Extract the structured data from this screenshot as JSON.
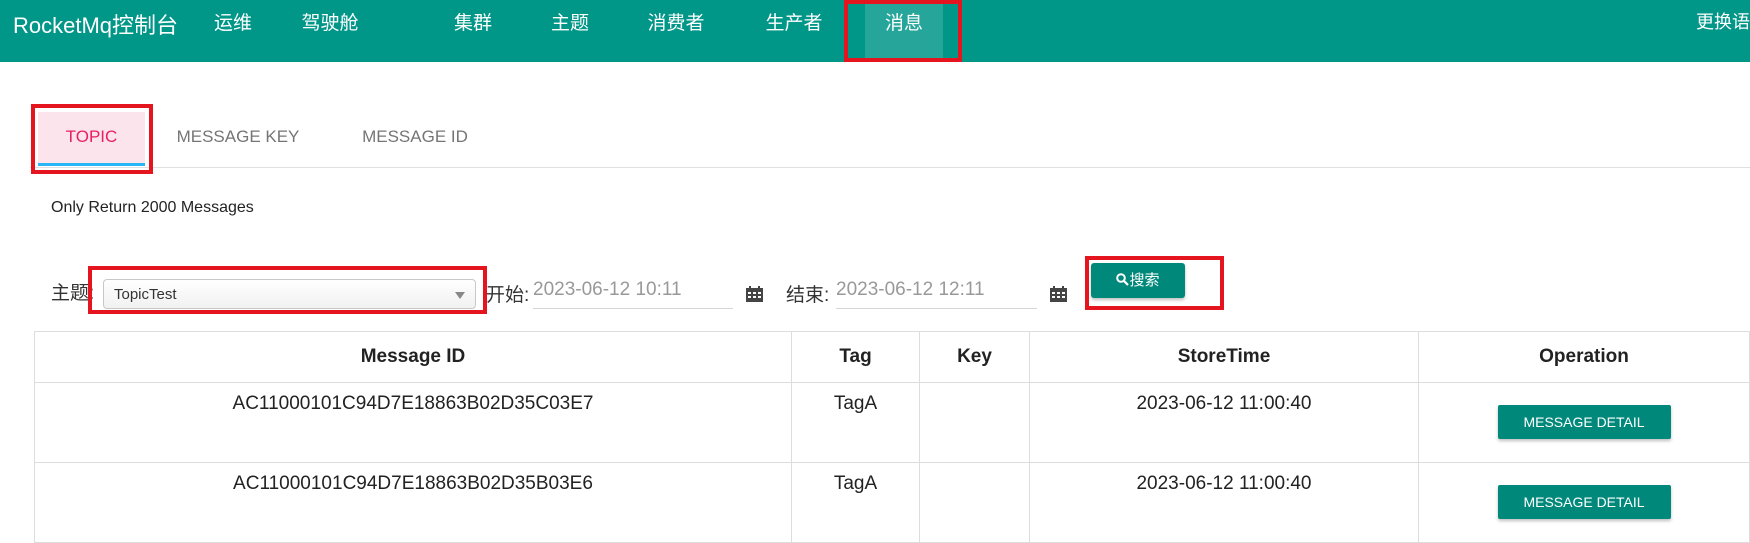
{
  "nav": {
    "brand": "RocketMq控制台",
    "items": [
      "运维",
      "驾驶舱",
      "集群",
      "主题",
      "消费者",
      "生产者",
      "消息"
    ],
    "active_index": 6,
    "lang": "更换语"
  },
  "tabs": [
    "TOPIC",
    "MESSAGE KEY",
    "MESSAGE ID"
  ],
  "active_tab": 0,
  "note": "Only Return 2000 Messages",
  "search": {
    "topic_label": "主题:",
    "topic_value": "TopicTest",
    "start_label": "开始:",
    "start_value": "2023-06-12 10:11",
    "end_label": "结束:",
    "end_value": "2023-06-12 12:11",
    "search_label": "搜索"
  },
  "table": {
    "headers": [
      "Message ID",
      "Tag",
      "Key",
      "StoreTime",
      "Operation"
    ],
    "rows": [
      {
        "id": "AC11000101C94D7E18863B02D35C03E7",
        "tag": "TagA",
        "key": "",
        "store_time": "2023-06-12 11:00:40",
        "op": "MESSAGE DETAIL"
      },
      {
        "id": "AC11000101C94D7E18863B02D35B03E6",
        "tag": "TagA",
        "key": "",
        "store_time": "2023-06-12 11:00:40",
        "op": "MESSAGE DETAIL"
      }
    ]
  },
  "colors": {
    "primary": "#009688",
    "button": "#00897b",
    "highlight": "#e4151f",
    "tab_active_text": "#e91e63"
  },
  "icons": {
    "search": "search-icon",
    "calendar": "calendar-icon",
    "dropdown": "chevron-down-icon"
  }
}
